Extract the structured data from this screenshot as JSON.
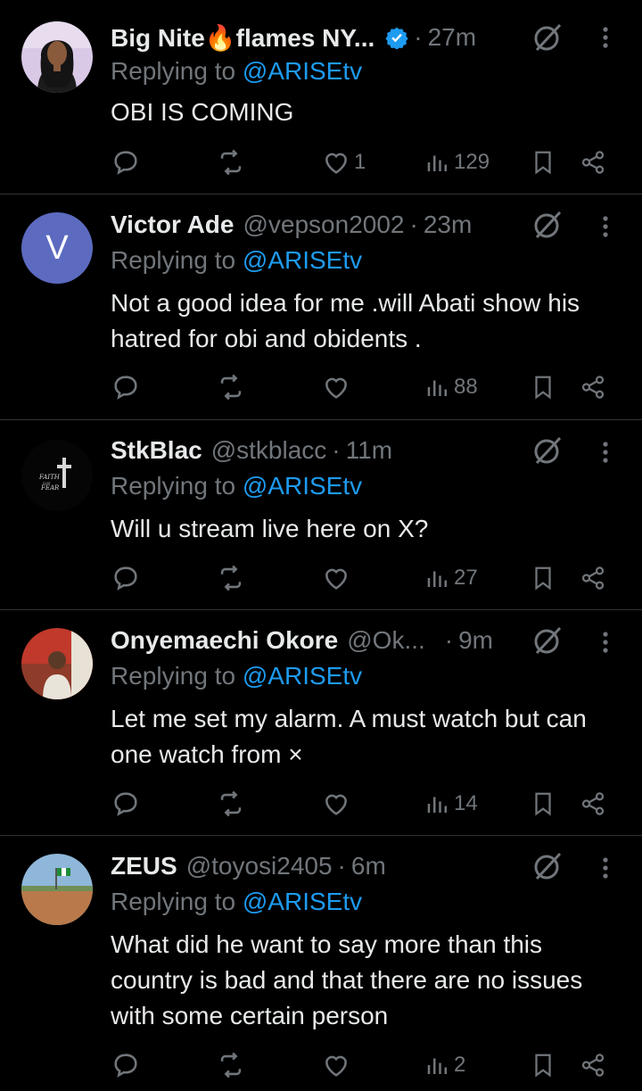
{
  "replies": [
    {
      "name": "Big Nite🔥flames NY...",
      "handle": "",
      "time": "27m",
      "verified": true,
      "replying_prefix": "Replying to ",
      "replying_to": "@ARISEtv",
      "text": "OBI IS COMING",
      "likes": "1",
      "views": "129",
      "avatar_type": "photo-woman"
    },
    {
      "name": "Victor Ade",
      "handle": "@vepson2002",
      "time": "23m",
      "verified": false,
      "replying_prefix": "Replying to ",
      "replying_to": "@ARISEtv",
      "text": "Not a good idea for me .will Abati show his hatred for obi and obidents .",
      "likes": "",
      "views": "88",
      "avatar_type": "letter",
      "avatar_letter": "V",
      "avatar_color": "#5c6bc0"
    },
    {
      "name": "StkBlac",
      "handle": "@stkblacc",
      "time": "11m",
      "verified": false,
      "replying_prefix": "Replying to ",
      "replying_to": "@ARISEtv",
      "text": "Will u stream live here on X?",
      "likes": "",
      "views": "27",
      "avatar_type": "cross-faith",
      "avatar_text_top": "FAITH",
      "avatar_text_mid": "over",
      "avatar_text_bottom": "FEAR"
    },
    {
      "name": "Onyemaechi Okore",
      "handle": "@Ok...",
      "time": "9m",
      "verified": false,
      "replying_prefix": "Replying to ",
      "replying_to": "@ARISEtv",
      "text": "Let me set my alarm. A must watch but can one watch from ×",
      "likes": "",
      "views": "14",
      "avatar_type": "photo-man"
    },
    {
      "name": "ZEUS",
      "handle": "@toyosi2405",
      "time": "6m",
      "verified": false,
      "replying_prefix": "Replying to ",
      "replying_to": "@ARISEtv",
      "text": "What did  he want to say more than this country is bad and that there are no issues with some certain person",
      "likes": "",
      "views": "2",
      "avatar_type": "photo-field"
    }
  ],
  "colors": {
    "background": "#000000",
    "primary_text": "#e7e9ea",
    "secondary_text": "#71767b",
    "link": "#1d9bf0",
    "divider": "#2f3336",
    "verified": "#1d9bf0"
  },
  "icons": [
    "reply-icon",
    "repost-icon",
    "like-icon",
    "views-icon",
    "bookmark-icon",
    "share-icon",
    "grok-icon",
    "more-icon",
    "verified-badge-icon"
  ]
}
